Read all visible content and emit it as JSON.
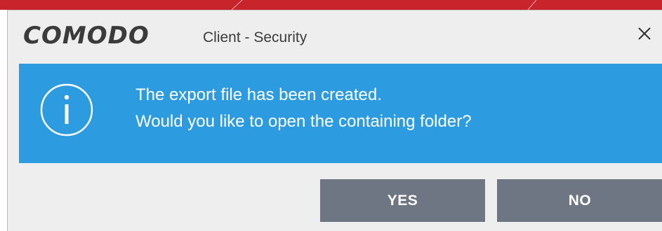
{
  "window": {
    "brand": "COMODO",
    "subtitle": "Client - Security",
    "close_icon": "close-icon"
  },
  "message": {
    "icon": "info-icon",
    "line1": "The export file has been created.",
    "line2": "Would you like to open the containing folder?"
  },
  "buttons": {
    "yes_label": "YES",
    "no_label": "NO"
  },
  "colors": {
    "top_banner": "#c8242b",
    "dialog_bg": "#eeeeee",
    "message_bg": "#2d9be0",
    "button_bg": "#6e7583",
    "text_light": "#ffffff",
    "text_dark": "#3b3b3b"
  }
}
